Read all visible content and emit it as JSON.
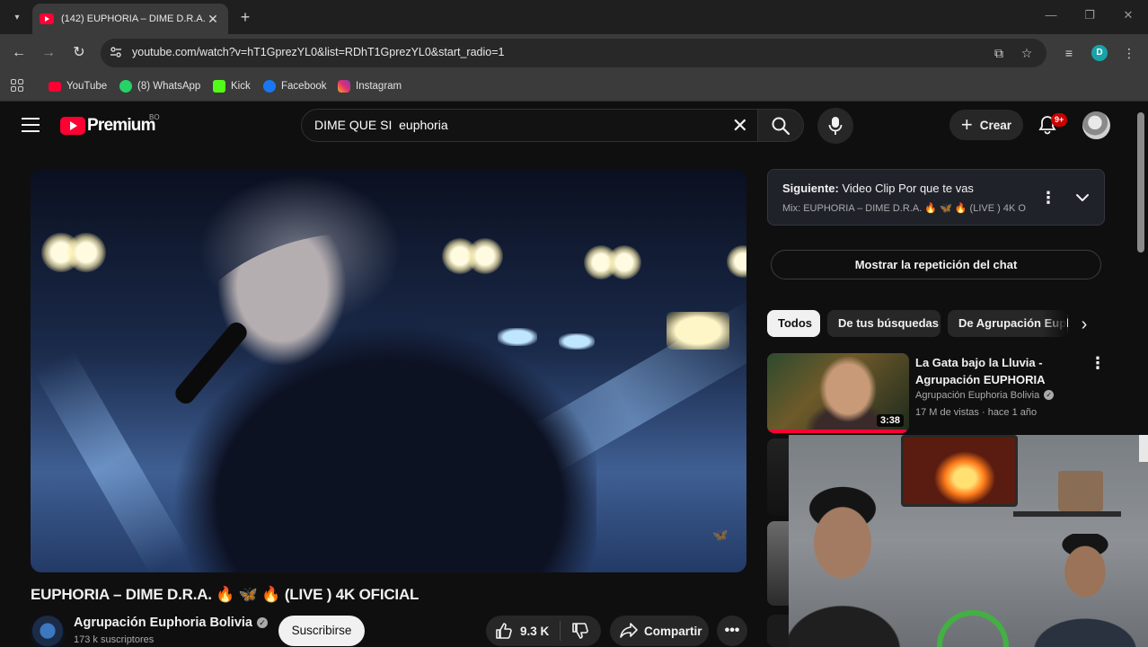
{
  "browser": {
    "tab_title": "(142) EUPHORIA – DIME D.R.A.",
    "new_tab_symbol": "+",
    "url": "youtube.com/watch?v=hT1GprezYL0&list=RDhT1GprezYL0&start_radio=1",
    "profile_initial": "D",
    "bookmarks": [
      {
        "label": "YouTube",
        "icon": "youtube-icon",
        "color": "#ff0033"
      },
      {
        "label": "(8) WhatsApp",
        "icon": "whatsapp-icon",
        "color": "#25d366"
      },
      {
        "label": "Kick",
        "icon": "kick-icon",
        "color": "#53fc18"
      },
      {
        "label": "Facebook",
        "icon": "facebook-icon",
        "color": "#1877f2"
      },
      {
        "label": "Instagram",
        "icon": "instagram-icon",
        "color": "#e1306c"
      }
    ]
  },
  "youtube": {
    "logo_text": "Premium",
    "country_code": "BO",
    "search_query": "DIME QUE SI  euphoria",
    "create_label": "Crear",
    "notifications_badge": "9+"
  },
  "video": {
    "title": "EUPHORIA – DIME D.R.A. 🔥 🦋 🔥 (LIVE ) 4K OFICIAL",
    "channel": "Agrupación Euphoria Bolivia",
    "subscribers": "173 k suscriptores",
    "subscribe_label": "Suscribirse",
    "likes": "9.3 K",
    "share_label": "Compartir"
  },
  "up_next": {
    "label": "Siguiente:",
    "title": "Video Clip Por que te vas",
    "mix": "Mix: EUPHORIA – DIME D.R.A. 🔥 🦋 🔥 (LIVE ) 4K O..."
  },
  "chat_replay_label": "Mostrar la repetición del chat",
  "chips": [
    "Todos",
    "De tus búsquedas",
    "De Agrupación Euphoria"
  ],
  "recommendations": [
    {
      "title": "La Gata bajo la Lluvia - Agrupación  EUPHORIA",
      "channel": "Agrupación Euphoria Bolivia",
      "meta": "17 M de vistas · hace 1 año",
      "duration": "3:38",
      "watched_fraction": 0.98
    }
  ],
  "colors": {
    "accent": "#ff0033",
    "background": "#0f0f0f",
    "chrome_toolbar": "#3b3b3b"
  }
}
